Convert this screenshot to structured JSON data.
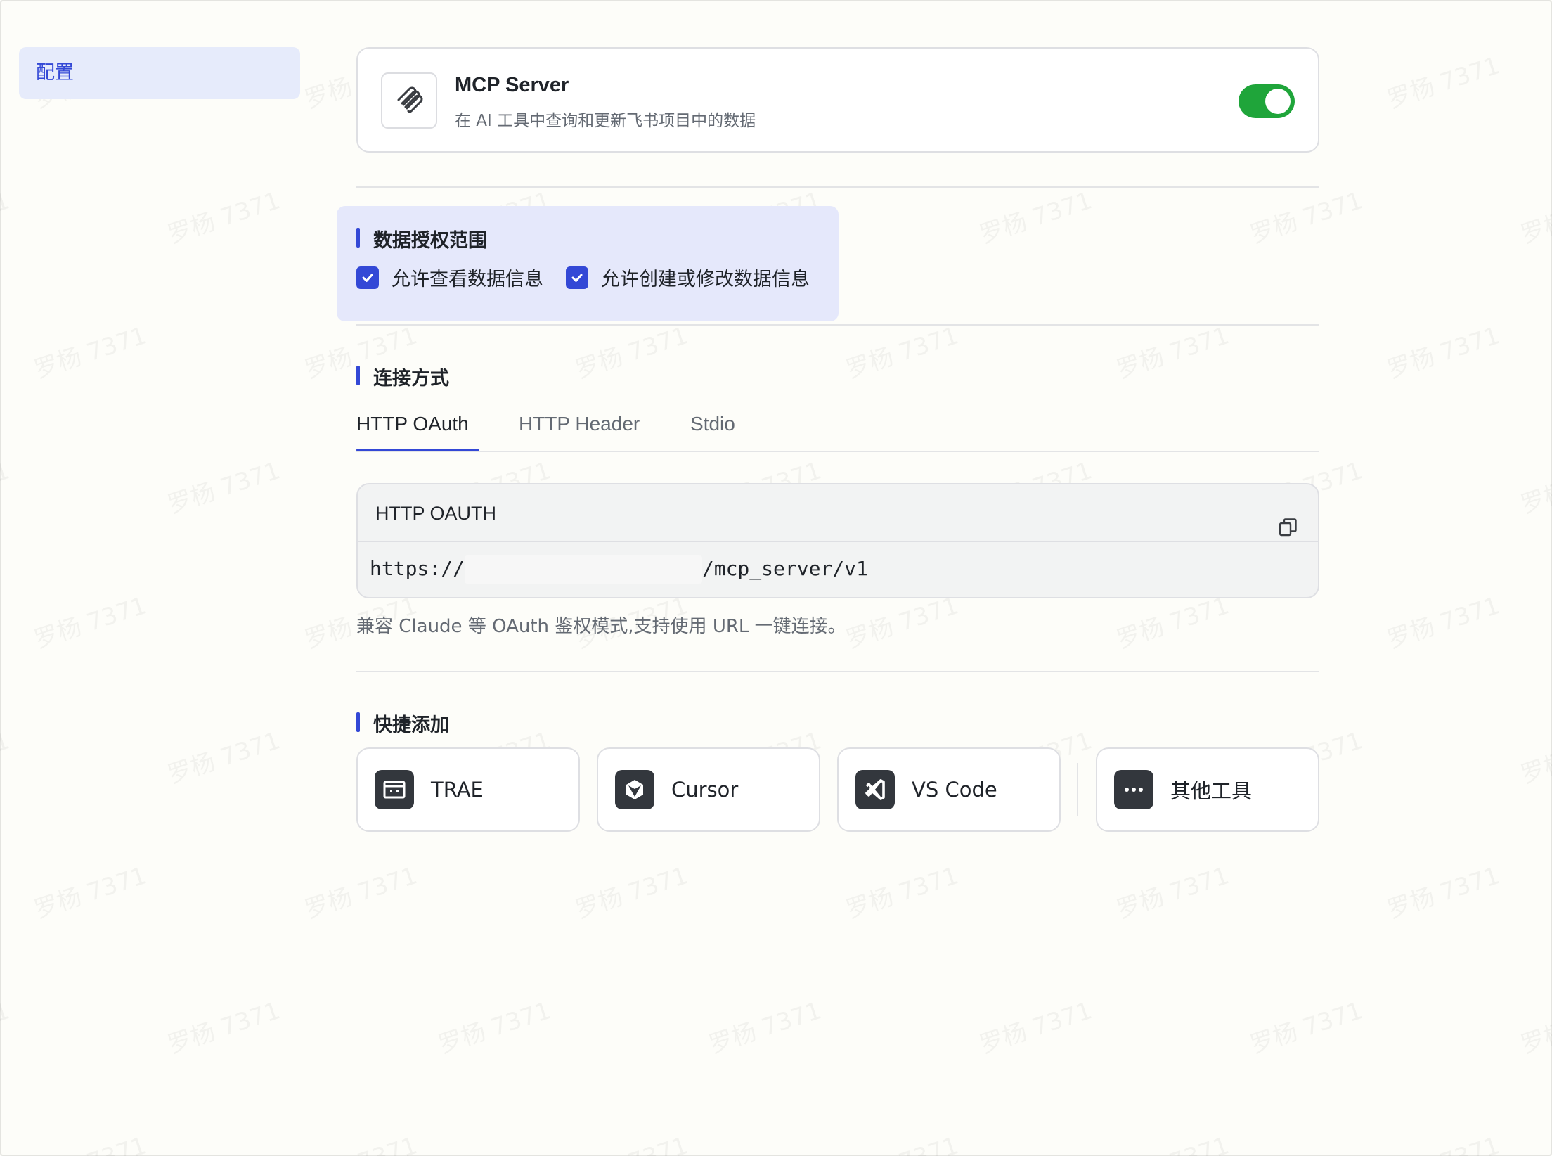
{
  "sidebar": {
    "items": [
      {
        "label": "配置",
        "active": true
      }
    ]
  },
  "server": {
    "title": "MCP Server",
    "description": "在 AI 工具中查询和更新飞书项目中的数据",
    "enabled": true,
    "icon": "mcp-logo-icon"
  },
  "scope": {
    "title": "数据授权范围",
    "options": [
      {
        "label": "允许查看数据信息",
        "checked": true
      },
      {
        "label": "允许创建或修改数据信息",
        "checked": true
      }
    ]
  },
  "connection": {
    "title": "连接方式",
    "tabs": [
      {
        "label": "HTTP OAuth",
        "active": true
      },
      {
        "label": "HTTP Header",
        "active": false
      },
      {
        "label": "Stdio",
        "active": false
      }
    ],
    "code": {
      "header": "HTTP OAUTH",
      "url_prefix": "https://",
      "url_suffix": "/mcp_server/v1"
    },
    "note": "兼容 Claude 等 OAuth 鉴权模式,支持使用 URL 一键连接。"
  },
  "quick_add": {
    "title": "快捷添加",
    "tools": [
      {
        "label": "TRAE",
        "icon": "trae-icon"
      },
      {
        "label": "Cursor",
        "icon": "cursor-icon"
      },
      {
        "label": "VS Code",
        "icon": "vscode-icon"
      },
      {
        "label": "其他工具",
        "icon": "more-dots-icon"
      }
    ]
  },
  "watermark": "罗杨 7371",
  "colors": {
    "accent": "#3348d6",
    "toggle_on": "#1fa53a",
    "scope_highlight": "#e5e8fb"
  }
}
